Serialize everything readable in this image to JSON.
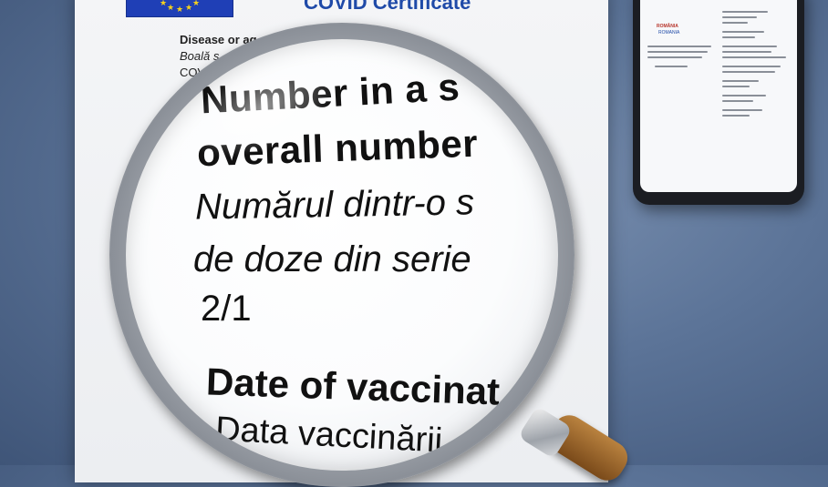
{
  "document": {
    "header_title": "COVID Certificate",
    "field_disease_en": "Disease or ag",
    "field_disease_ro": "Boală s",
    "field_disease_value": "COV"
  },
  "magnified": {
    "heading_line1": "Number in a s",
    "heading_line2": "overall number",
    "ro_line1": "Numărul dintr-o s",
    "ro_line2": "de doze din serie",
    "value": "2/1",
    "next_heading": "Date of vaccinat",
    "next_ro": "Data vaccinării"
  },
  "phone": {
    "emblem_text": "ROMÂNIA",
    "emblem_subtext": "ROMANIA"
  },
  "colors": {
    "background": "#5c7498",
    "eu_blue": "#1f3fb6",
    "eu_star": "#f7d21b",
    "title_blue": "#1f4aa8"
  }
}
